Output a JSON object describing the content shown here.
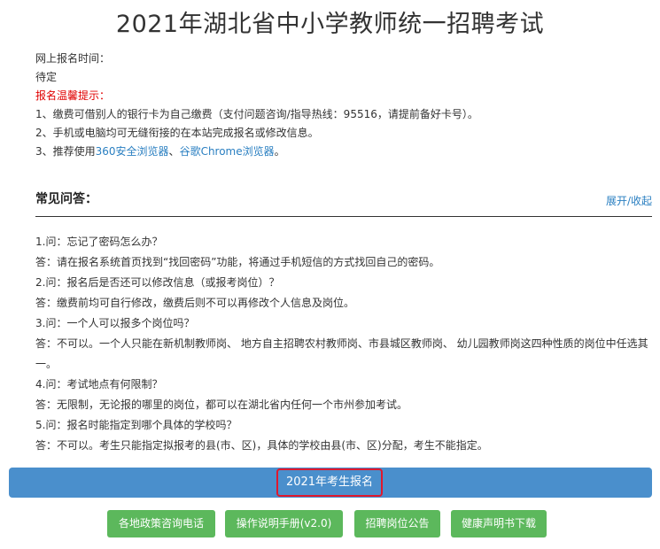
{
  "page_title": "2021年湖北省中小学教师统一招聘考试",
  "notice": {
    "time_label": "网上报名时间：",
    "time_value": "待定",
    "tips_title": "报名温馨提示：",
    "tip1": "1、缴费可借别人的银行卡为自己缴费（支付问题咨询/指导热线：95516，请提前备好卡号）。",
    "tip2": "2、手机或电脑均可无缝衔接的在本站完成报名或修改信息。",
    "tip3_prefix": "3、推荐使用",
    "browser1": "360安全浏览器",
    "sep": "、",
    "browser2": "谷歌Chrome浏览器",
    "tip3_suffix": "。"
  },
  "faq": {
    "title": "常见问答：",
    "toggle": "展开/收起",
    "items": [
      {
        "q": "1.问：忘记了密码怎么办？",
        "a": "答：请在报名系统首页找到“找回密码”功能，将通过手机短信的方式找回自己的密码。"
      },
      {
        "q": "2.问：报名后是否还可以修改信息（或报考岗位）？",
        "a": "答：缴费前均可自行修改，缴费后则不可以再修改个人信息及岗位。"
      },
      {
        "q": "3.问：一个人可以报多个岗位吗？",
        "a": "答：不可以。一个人只能在新机制教师岗、 地方自主招聘农村教师岗、市县城区教师岗、 幼儿园教师岗这四种性质的岗位中任选其一。"
      },
      {
        "q": "4.问：考试地点有何限制？",
        "a": "答：无限制，无论报的哪里的岗位，都可以在湖北省内任何一个市州参加考试。"
      },
      {
        "q": "5.问：报名时能指定到哪个具体的学校吗？",
        "a": "答：不可以。考生只能指定拟报考的县(市、区)，具体的学校由县(市、区)分配，考生不能指定。"
      }
    ]
  },
  "register_button": "2021年考生报名",
  "buttons": [
    {
      "label": "各地政策咨询电话"
    },
    {
      "label": "操作说明手册(v2.0)"
    },
    {
      "label": "招聘岗位公告"
    },
    {
      "label": "健康声明书下载"
    }
  ],
  "colors": {
    "accent_blue": "#4a8fcc",
    "green": "#5cb85c",
    "highlight_red": "#e0182d",
    "link": "#2a7fc1"
  }
}
